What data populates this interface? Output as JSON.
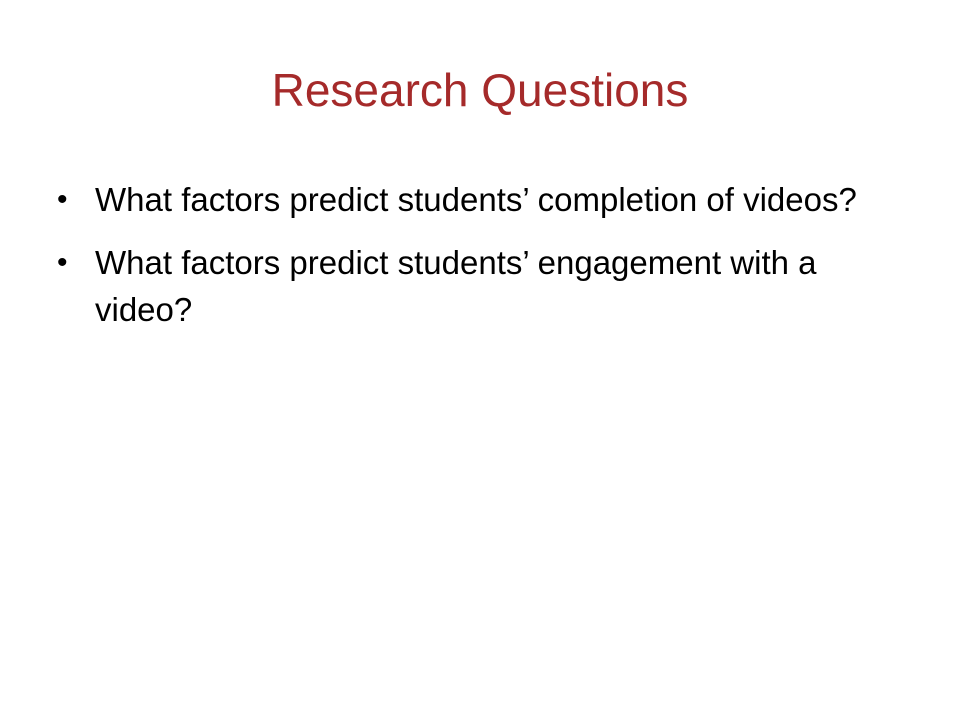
{
  "slide": {
    "title": "Research Questions",
    "bullets": [
      {
        "marker": "•",
        "text": "What factors predict students’ completion of videos?"
      },
      {
        "marker": "•",
        "text": "What factors predict students’ engagement with a video?"
      }
    ]
  },
  "colors": {
    "title": "#a52a2a",
    "body_text": "#000000",
    "background": "#ffffff"
  }
}
